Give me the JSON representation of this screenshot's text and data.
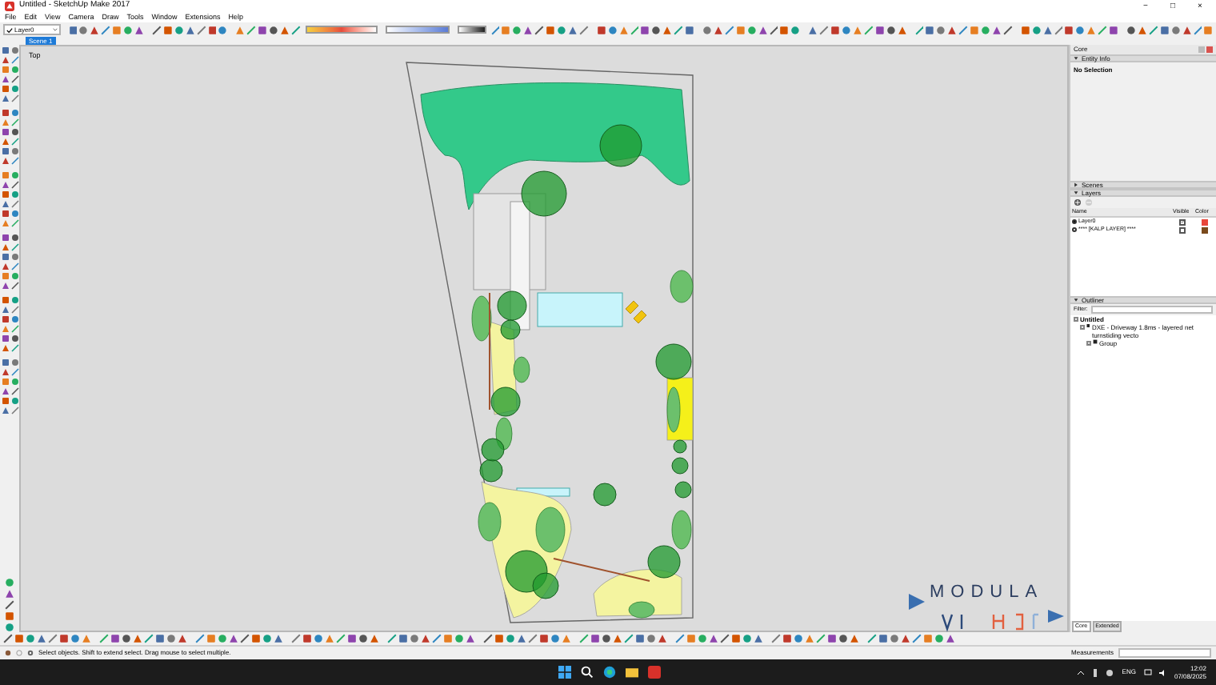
{
  "window": {
    "title": "Untitled - SketchUp Make 2017",
    "controls": [
      "−",
      "□",
      "×"
    ]
  },
  "menu": [
    "File",
    "Edit",
    "View",
    "Camera",
    "Draw",
    "Tools",
    "Window",
    "Extensions",
    "Help"
  ],
  "layer_dropdown": {
    "value": "Layer0"
  },
  "scene_tabs": [
    {
      "label": "Scene 1",
      "selected": true
    }
  ],
  "viewport": {
    "view_label": "Top",
    "logo": {
      "text": "MODULA"
    }
  },
  "tray": {
    "title": "Core",
    "entity_info": {
      "title": "Entity Info",
      "expanded": true,
      "value": "No Selection"
    },
    "scenes": {
      "title": "Scenes",
      "expanded": false
    },
    "layers": {
      "title": "Layers",
      "expanded": true,
      "columns": [
        "Name",
        "Visible",
        "Color"
      ],
      "rows": [
        {
          "name": "Layer0",
          "selected": true,
          "visible": true,
          "color": "#e8463a"
        },
        {
          "name": "**** [KALP LAYER] ****",
          "selected": false,
          "visible": false,
          "color": "#7a4a1c"
        }
      ]
    },
    "outliner": {
      "title": "Outliner",
      "expanded": true,
      "filter_label": "Filter:",
      "tree": [
        {
          "label": "Untitled",
          "expanded": true,
          "children": [
            {
              "label": "DXE - Driveway 1.8ms - layered net turnstiding vecto",
              "expanded": true,
              "children": [
                {
                  "label": "Group",
                  "expanded": false
                }
              ]
            }
          ]
        }
      ]
    },
    "tabs": [
      {
        "label": "Core",
        "selected": true
      },
      {
        "label": "Extended",
        "selected": false
      }
    ]
  },
  "status_bar": {
    "text": "Select objects. Shift to extend select. Drag mouse to select multiple.",
    "measurements_label": "Measurements"
  },
  "taskbar": {
    "language": "ENG",
    "time": "12:02",
    "date": "07/08/2025"
  }
}
